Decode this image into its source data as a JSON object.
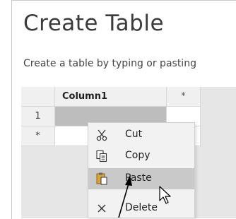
{
  "dialog": {
    "title": "Create Table",
    "subtitle": "Create a table by typing or pasting"
  },
  "grid": {
    "column_header": "Column1",
    "new_column_marker": "*",
    "rows": [
      {
        "header": "1",
        "value": ""
      },
      {
        "header": "*",
        "value": ""
      }
    ]
  },
  "context_menu": {
    "items": [
      {
        "label": "Cut",
        "icon": "scissors-icon"
      },
      {
        "label": "Copy",
        "icon": "copy-icon"
      },
      {
        "label": "Paste",
        "icon": "paste-icon",
        "highlighted": true
      },
      {
        "label": "Delete",
        "icon": "delete-icon"
      }
    ]
  },
  "colors": {
    "highlight": "#c9c9c9",
    "menu_bg": "#f2f2f2",
    "grid_bg": "#e6e6e6",
    "selected_cell": "#bdbdbd"
  }
}
